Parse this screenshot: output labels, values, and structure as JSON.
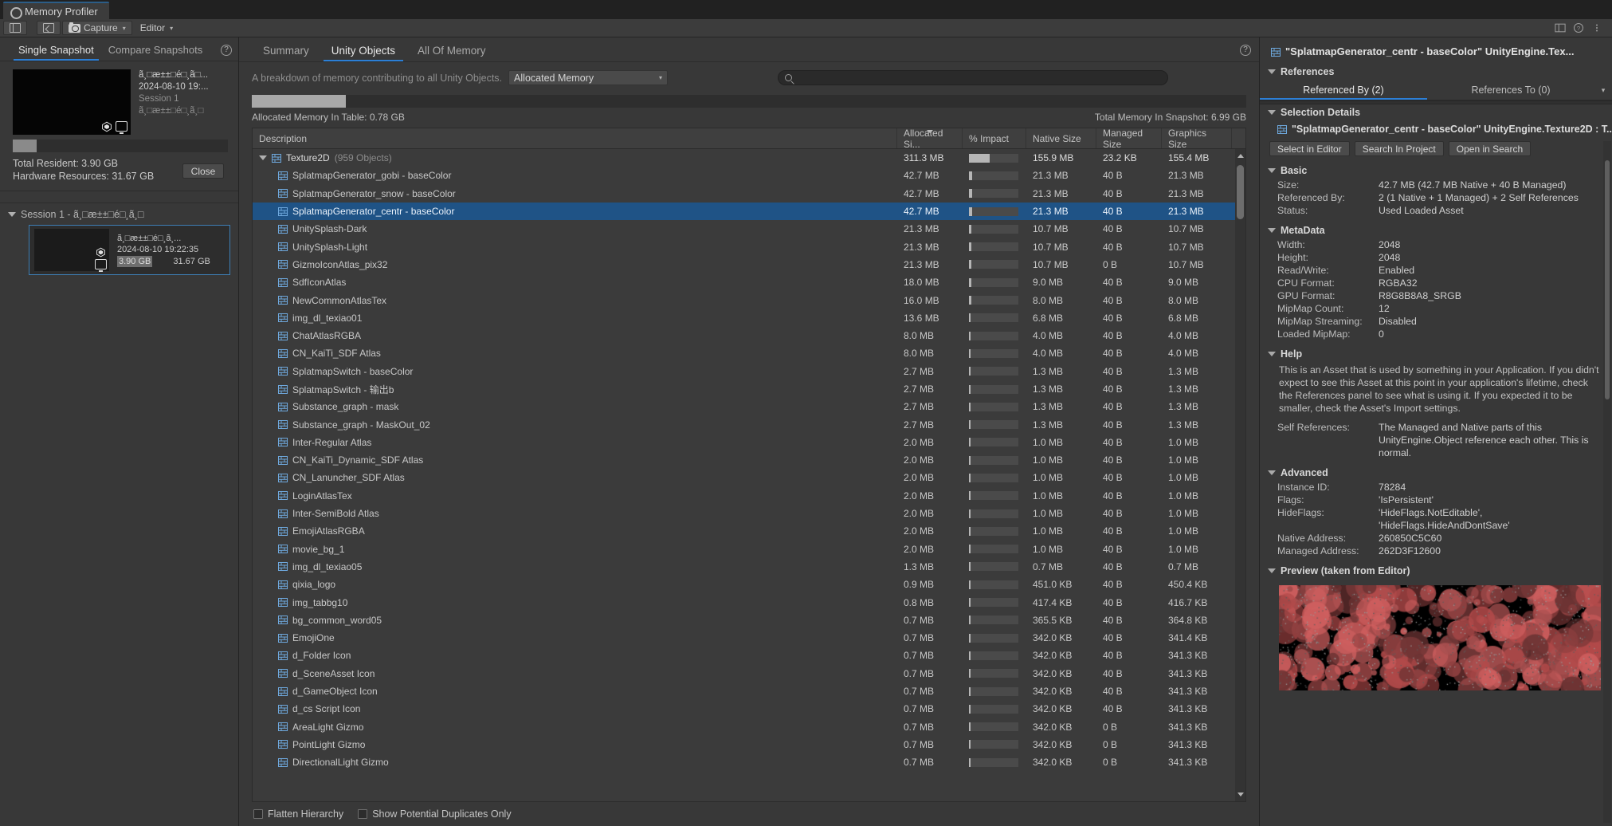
{
  "window": {
    "tab_title": "Memory Profiler",
    "gear_icon": "gear-icon"
  },
  "toolbar": {
    "panel_icon": "panel-layout-icon",
    "import_icon": "import-snapshot-icon",
    "capture_label": "Capture",
    "capture_icon": "camera-icon",
    "target_label": "Editor",
    "caret": "▾",
    "right_icons": [
      "layout-icon",
      "help-icon",
      "menu-icon"
    ]
  },
  "left_panel": {
    "tabs": [
      {
        "label": "Single Snapshot",
        "active": true
      },
      {
        "label": "Compare Snapshots",
        "active": false
      }
    ],
    "help_badge": "?",
    "open_snapshot": {
      "name": "ã¸□æ±±□é□¸ã□...",
      "timestamp": "2024-08-10 19:...",
      "session": "Session 1",
      "subtitle": "ã¸□æ±±□é□¸ã¸□",
      "unity_icon": "unity-logo-icon",
      "platform_icon": "desktop-monitor-icon"
    },
    "total_resident": "Total Resident: 3.90 GB",
    "hardware_resources": "Hardware Resources: 31.67 GB",
    "close_label": "Close",
    "session_header": "Session 1 - ã¸□æ±±□é□¸ã¸□",
    "session_snapshot": {
      "name": "ã¸□æ±±□é□¸ã¸...",
      "timestamp": "2024-08-10 19:22:35",
      "size_resident": "3.90 GB",
      "size_hardware": "31.67 GB",
      "unity_icon": "unity-logo-icon",
      "platform_icon": "desktop-monitor-icon"
    }
  },
  "center_panel": {
    "tabs": [
      {
        "label": "Summary",
        "active": false
      },
      {
        "label": "Unity Objects",
        "active": true
      },
      {
        "label": "All Of Memory",
        "active": false
      }
    ],
    "help_badge": "?",
    "breakdown_label": "A breakdown of memory contributing to all Unity Objects.",
    "breakdown_value": "Allocated Memory",
    "breakdown_caret": "▾",
    "search_placeholder": "",
    "search_value": "",
    "search_icon": "search-icon",
    "allocated_in_table": "Allocated Memory In Table: 0.78 GB",
    "total_in_snapshot": "Total Memory In Snapshot: 6.99 GB",
    "columns": [
      {
        "key": "description",
        "label": "Description",
        "sorted": false
      },
      {
        "key": "allocated",
        "label": "Allocated Si...",
        "sorted": true
      },
      {
        "key": "impact",
        "label": "% Impact",
        "sorted": false
      },
      {
        "key": "native",
        "label": "Native Size",
        "sorted": false
      },
      {
        "key": "managed",
        "label": "Managed Size",
        "sorted": false
      },
      {
        "key": "graphics",
        "label": "Graphics Size",
        "sorted": false
      }
    ],
    "rows": [
      {
        "name": "Texture2D",
        "count": "(959 Objects)",
        "group": true,
        "expanded": true,
        "allocated": "311.3 MB",
        "impact": 42,
        "native": "155.9 MB",
        "managed": "23.2 KB",
        "graphics": "155.4 MB",
        "selected": false
      },
      {
        "name": "SplatmapGenerator_gobi - baseColor",
        "group": false,
        "allocated": "42.7 MB",
        "impact": 6,
        "native": "21.3 MB",
        "managed": "40 B",
        "graphics": "21.3 MB",
        "selected": false
      },
      {
        "name": "SplatmapGenerator_snow - baseColor",
        "group": false,
        "allocated": "42.7 MB",
        "impact": 6,
        "native": "21.3 MB",
        "managed": "40 B",
        "graphics": "21.3 MB",
        "selected": false
      },
      {
        "name": "SplatmapGenerator_centr - baseColor",
        "group": false,
        "allocated": "42.7 MB",
        "impact": 6,
        "native": "21.3 MB",
        "managed": "40 B",
        "graphics": "21.3 MB",
        "selected": true
      },
      {
        "name": "UnitySplash-Dark",
        "group": false,
        "allocated": "21.3 MB",
        "impact": 5,
        "native": "10.7 MB",
        "managed": "40 B",
        "graphics": "10.7 MB",
        "selected": false
      },
      {
        "name": "UnitySplash-Light",
        "group": false,
        "allocated": "21.3 MB",
        "impact": 5,
        "native": "10.7 MB",
        "managed": "40 B",
        "graphics": "10.7 MB",
        "selected": false
      },
      {
        "name": "GizmoIconAtlas_pix32",
        "group": false,
        "allocated": "21.3 MB",
        "impact": 5,
        "native": "10.7 MB",
        "managed": "0 B",
        "graphics": "10.7 MB",
        "selected": false
      },
      {
        "name": "SdfIconAtlas",
        "group": false,
        "allocated": "18.0 MB",
        "impact": 5,
        "native": "9.0 MB",
        "managed": "40 B",
        "graphics": "9.0 MB",
        "selected": false
      },
      {
        "name": "NewCommonAtlasTex",
        "group": false,
        "allocated": "16.0 MB",
        "impact": 5,
        "native": "8.0 MB",
        "managed": "40 B",
        "graphics": "8.0 MB",
        "selected": false
      },
      {
        "name": "img_dl_texiao01",
        "group": false,
        "allocated": "13.6 MB",
        "impact": 4,
        "native": "6.8 MB",
        "managed": "40 B",
        "graphics": "6.8 MB",
        "selected": false
      },
      {
        "name": "ChatAtlasRGBA",
        "group": false,
        "allocated": "8.0 MB",
        "impact": 4,
        "native": "4.0 MB",
        "managed": "40 B",
        "graphics": "4.0 MB",
        "selected": false
      },
      {
        "name": "CN_KaiTi_SDF Atlas",
        "group": false,
        "allocated": "8.0 MB",
        "impact": 4,
        "native": "4.0 MB",
        "managed": "40 B",
        "graphics": "4.0 MB",
        "selected": false
      },
      {
        "name": "SplatmapSwitch - baseColor",
        "group": false,
        "allocated": "2.7 MB",
        "impact": 4,
        "native": "1.3 MB",
        "managed": "40 B",
        "graphics": "1.3 MB",
        "selected": false
      },
      {
        "name": "SplatmapSwitch - 输出b",
        "group": false,
        "allocated": "2.7 MB",
        "impact": 4,
        "native": "1.3 MB",
        "managed": "40 B",
        "graphics": "1.3 MB",
        "selected": false
      },
      {
        "name": "Substance_graph - mask",
        "group": false,
        "allocated": "2.7 MB",
        "impact": 4,
        "native": "1.3 MB",
        "managed": "40 B",
        "graphics": "1.3 MB",
        "selected": false
      },
      {
        "name": "Substance_graph - MaskOut_02",
        "group": false,
        "allocated": "2.7 MB",
        "impact": 4,
        "native": "1.3 MB",
        "managed": "40 B",
        "graphics": "1.3 MB",
        "selected": false
      },
      {
        "name": "Inter-Regular Atlas",
        "group": false,
        "allocated": "2.0 MB",
        "impact": 4,
        "native": "1.0 MB",
        "managed": "40 B",
        "graphics": "1.0 MB",
        "selected": false
      },
      {
        "name": "CN_KaiTi_Dynamic_SDF Atlas",
        "group": false,
        "allocated": "2.0 MB",
        "impact": 4,
        "native": "1.0 MB",
        "managed": "40 B",
        "graphics": "1.0 MB",
        "selected": false
      },
      {
        "name": "CN_Lanuncher_SDF Atlas",
        "group": false,
        "allocated": "2.0 MB",
        "impact": 4,
        "native": "1.0 MB",
        "managed": "40 B",
        "graphics": "1.0 MB",
        "selected": false
      },
      {
        "name": "LoginAtlasTex",
        "group": false,
        "allocated": "2.0 MB",
        "impact": 4,
        "native": "1.0 MB",
        "managed": "40 B",
        "graphics": "1.0 MB",
        "selected": false
      },
      {
        "name": "Inter-SemiBold Atlas",
        "group": false,
        "allocated": "2.0 MB",
        "impact": 4,
        "native": "1.0 MB",
        "managed": "40 B",
        "graphics": "1.0 MB",
        "selected": false
      },
      {
        "name": "EmojiAtlasRGBA",
        "group": false,
        "allocated": "2.0 MB",
        "impact": 4,
        "native": "1.0 MB",
        "managed": "40 B",
        "graphics": "1.0 MB",
        "selected": false
      },
      {
        "name": "movie_bg_1",
        "group": false,
        "allocated": "2.0 MB",
        "impact": 4,
        "native": "1.0 MB",
        "managed": "40 B",
        "graphics": "1.0 MB",
        "selected": false
      },
      {
        "name": "img_dl_texiao05",
        "group": false,
        "allocated": "1.3 MB",
        "impact": 4,
        "native": "0.7 MB",
        "managed": "40 B",
        "graphics": "0.7 MB",
        "selected": false
      },
      {
        "name": "qixia_logo",
        "group": false,
        "allocated": "0.9 MB",
        "impact": 4,
        "native": "451.0 KB",
        "managed": "40 B",
        "graphics": "450.4 KB",
        "selected": false
      },
      {
        "name": "img_tabbg10",
        "group": false,
        "allocated": "0.8 MB",
        "impact": 4,
        "native": "417.4 KB",
        "managed": "40 B",
        "graphics": "416.7 KB",
        "selected": false
      },
      {
        "name": "bg_common_word05",
        "group": false,
        "allocated": "0.7 MB",
        "impact": 4,
        "native": "365.5 KB",
        "managed": "40 B",
        "graphics": "364.8 KB",
        "selected": false
      },
      {
        "name": "EmojiOne",
        "group": false,
        "allocated": "0.7 MB",
        "impact": 4,
        "native": "342.0 KB",
        "managed": "40 B",
        "graphics": "341.4 KB",
        "selected": false
      },
      {
        "name": "d_Folder Icon",
        "group": false,
        "allocated": "0.7 MB",
        "impact": 4,
        "native": "342.0 KB",
        "managed": "40 B",
        "graphics": "341.3 KB",
        "selected": false
      },
      {
        "name": "d_SceneAsset Icon",
        "group": false,
        "allocated": "0.7 MB",
        "impact": 4,
        "native": "342.0 KB",
        "managed": "40 B",
        "graphics": "341.3 KB",
        "selected": false
      },
      {
        "name": "d_GameObject Icon",
        "group": false,
        "allocated": "0.7 MB",
        "impact": 4,
        "native": "342.0 KB",
        "managed": "40 B",
        "graphics": "341.3 KB",
        "selected": false
      },
      {
        "name": "d_cs Script Icon",
        "group": false,
        "allocated": "0.7 MB",
        "impact": 4,
        "native": "342.0 KB",
        "managed": "40 B",
        "graphics": "341.3 KB",
        "selected": false
      },
      {
        "name": "AreaLight Gizmo",
        "group": false,
        "allocated": "0.7 MB",
        "impact": 4,
        "native": "342.0 KB",
        "managed": "0 B",
        "graphics": "341.3 KB",
        "selected": false
      },
      {
        "name": "PointLight Gizmo",
        "group": false,
        "allocated": "0.7 MB",
        "impact": 4,
        "native": "342.0 KB",
        "managed": "0 B",
        "graphics": "341.3 KB",
        "selected": false
      },
      {
        "name": "DirectionalLight Gizmo",
        "group": false,
        "allocated": "0.7 MB",
        "impact": 4,
        "native": "342.0 KB",
        "managed": "0 B",
        "graphics": "341.3 KB",
        "selected": false
      }
    ],
    "footer": {
      "flatten_label": "Flatten Hierarchy",
      "duplicates_label": "Show Potential Duplicates Only"
    }
  },
  "right_panel": {
    "title": "\"SplatmapGenerator_centr - baseColor\" UnityEngine.Tex...",
    "references_label": "References",
    "ref_tabs": [
      {
        "label": "Referenced By (2)",
        "active": true
      },
      {
        "label": "References To (0)",
        "active": false
      }
    ],
    "ref_caret": "▾",
    "selection_details_label": "Selection Details",
    "selected_object": "\"SplatmapGenerator_centr - baseColor\" UnityEngine.Texture2D : T...",
    "buttons": [
      "Select in Editor",
      "Search In Project",
      "Open in Search"
    ],
    "basic_label": "Basic",
    "basic_rows": [
      {
        "key": "Size:",
        "value": "42.7 MB (42.7 MB Native + 40 B Managed)"
      },
      {
        "key": "Referenced By:",
        "value": "2 (1 Native + 1 Managed) + 2 Self References"
      },
      {
        "key": "Status:",
        "value": "Used Loaded Asset"
      }
    ],
    "metadata_label": "MetaData",
    "metadata_rows": [
      {
        "key": "Width:",
        "value": "2048"
      },
      {
        "key": "Height:",
        "value": "2048"
      },
      {
        "key": "Read/Write:",
        "value": "Enabled"
      },
      {
        "key": "CPU Format:",
        "value": "RGBA32"
      },
      {
        "key": "GPU Format:",
        "value": "R8G8B8A8_SRGB"
      },
      {
        "key": "MipMap Count:",
        "value": "12"
      },
      {
        "key": "MipMap Streaming:",
        "value": "Disabled"
      },
      {
        "key": "Loaded MipMap:",
        "value": "0"
      }
    ],
    "help_label": "Help",
    "help_text": "This is an Asset that is used by something in your Application. If you didn't expect to see this Asset at this point in your application's lifetime, check the References panel to see what is using it. If you expected it to be smaller, check the Asset's Import settings.",
    "self_ref_key": "Self References:",
    "self_ref_value": "The Managed and Native parts of this UnityEngine.Object reference each other. This is normal.",
    "advanced_label": "Advanced",
    "advanced_rows": [
      {
        "key": "Instance ID:",
        "value": "78284"
      },
      {
        "key": "Flags:",
        "value": "'IsPersistent'"
      },
      {
        "key": "HideFlags:",
        "value": "'HideFlags.NotEditable', 'HideFlags.HideAndDontSave'"
      },
      {
        "key": "Native Address:",
        "value": "260850C5C60"
      },
      {
        "key": "Managed Address:",
        "value": "262D3F12600"
      }
    ],
    "preview_label": "Preview (taken from Editor)"
  },
  "colors": {
    "accent": "#2c7fd6",
    "selection": "#1f5386",
    "bg": "#383838",
    "panel": "#3b3b3b",
    "text": "#c8c8c8"
  }
}
